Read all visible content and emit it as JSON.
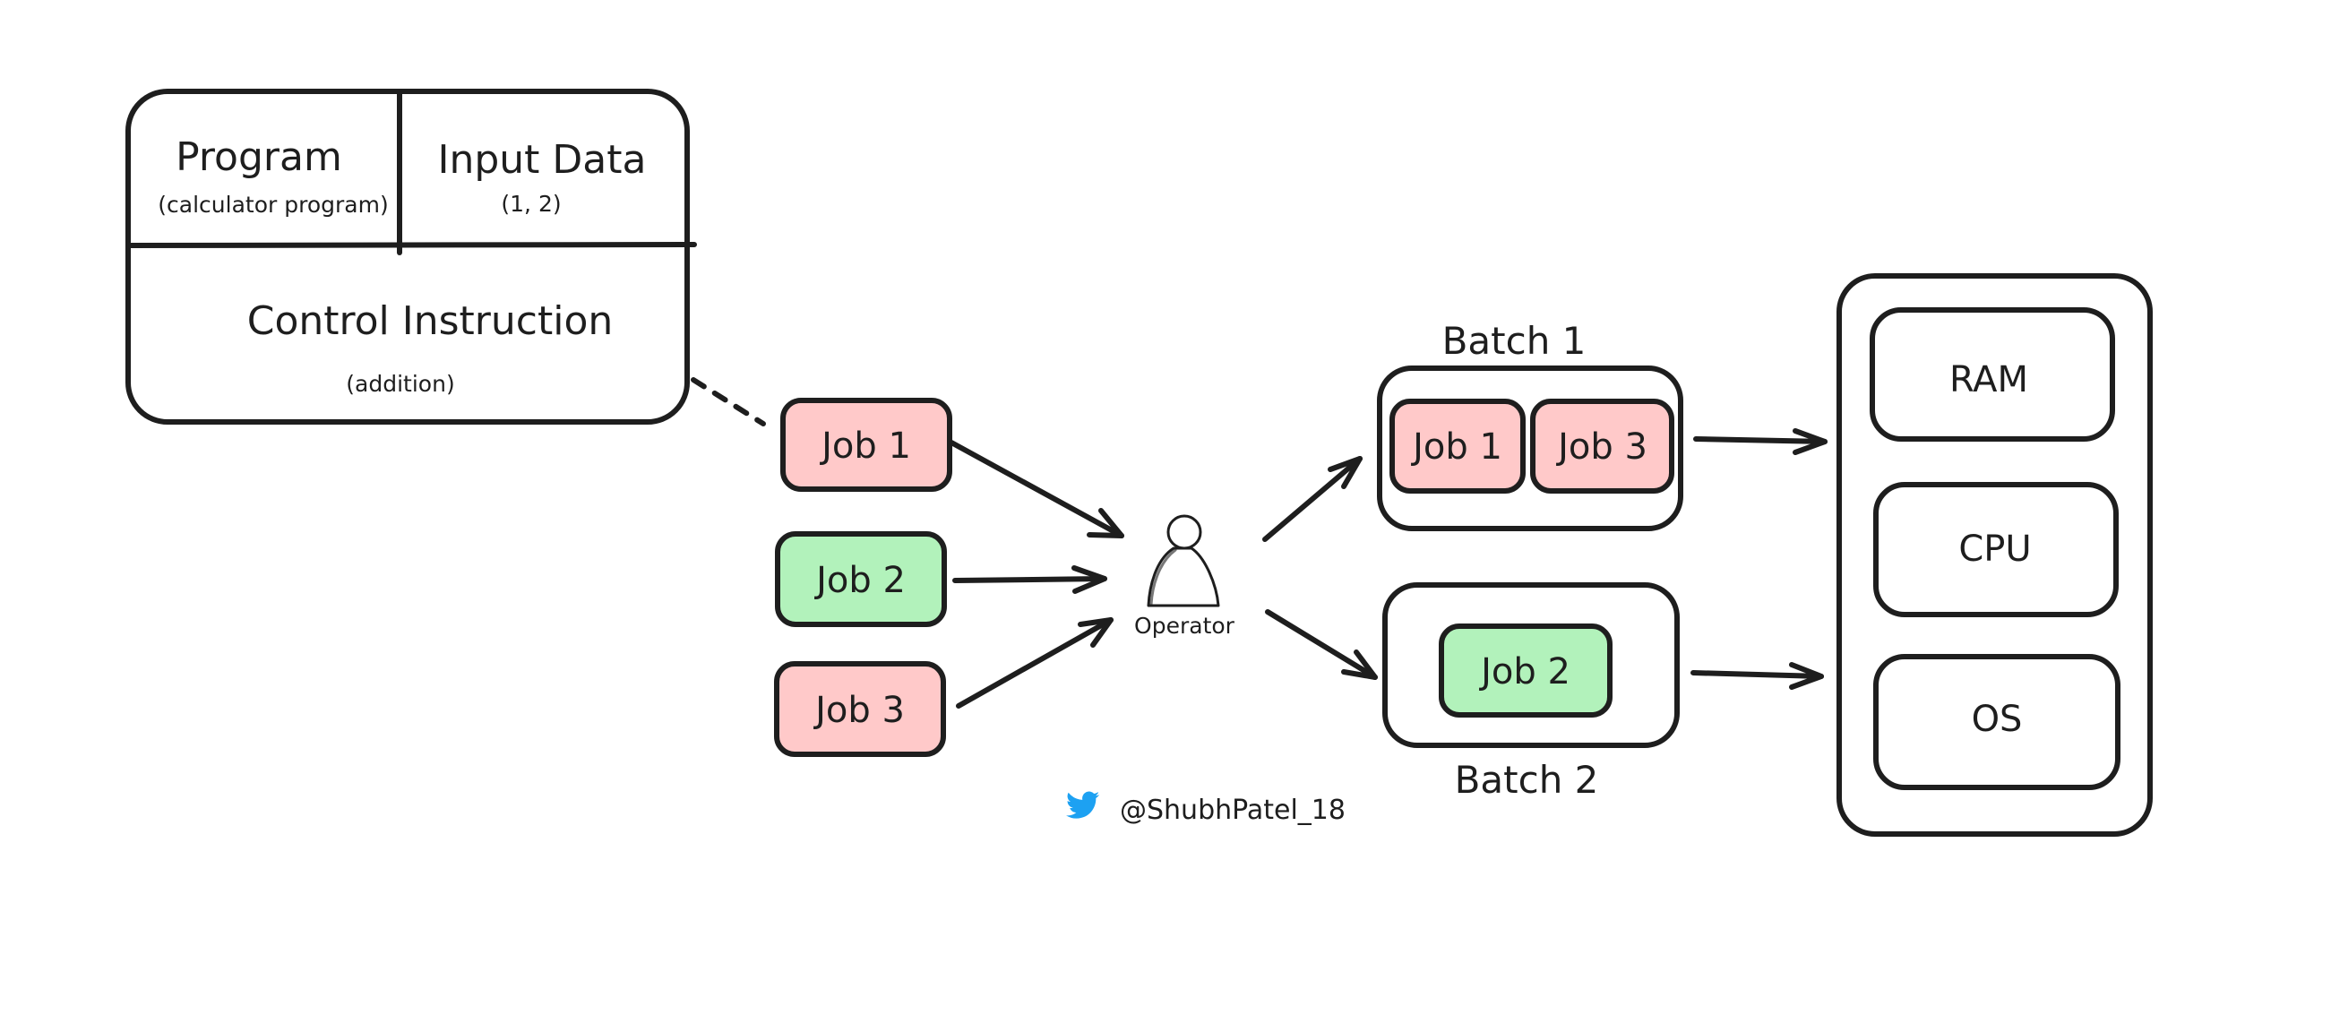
{
  "job_definition": {
    "program_label": "Program",
    "program_sub": "(calculator program)",
    "input_label": "Input Data",
    "input_sub": "(1, 2)",
    "control_label": "Control Instruction",
    "control_sub": "(addition)"
  },
  "jobs": [
    {
      "label": "Job 1",
      "color": "#ffc9c9"
    },
    {
      "label": "Job 2",
      "color": "#b2f2bb"
    },
    {
      "label": "Job 3",
      "color": "#ffc9c9"
    }
  ],
  "operator": {
    "label": "Operator",
    "icon": "person-icon"
  },
  "batches": [
    {
      "title": "Batch 1",
      "jobs": [
        {
          "label": "Job 1",
          "color": "#ffc9c9"
        },
        {
          "label": "Job 3",
          "color": "#ffc9c9"
        }
      ]
    },
    {
      "title": "Batch 2",
      "jobs": [
        {
          "label": "Job 2",
          "color": "#b2f2bb"
        }
      ]
    }
  ],
  "resources": [
    {
      "label": "RAM"
    },
    {
      "label": "CPU"
    },
    {
      "label": "OS"
    }
  ],
  "credit": {
    "handle": "@ShubhPatel_18",
    "icon": "twitter-bird-icon",
    "icon_color": "#1da1f2"
  },
  "colors": {
    "stroke": "#1e1e1e",
    "job_red": "#ffc9c9",
    "job_green": "#b2f2bb"
  }
}
